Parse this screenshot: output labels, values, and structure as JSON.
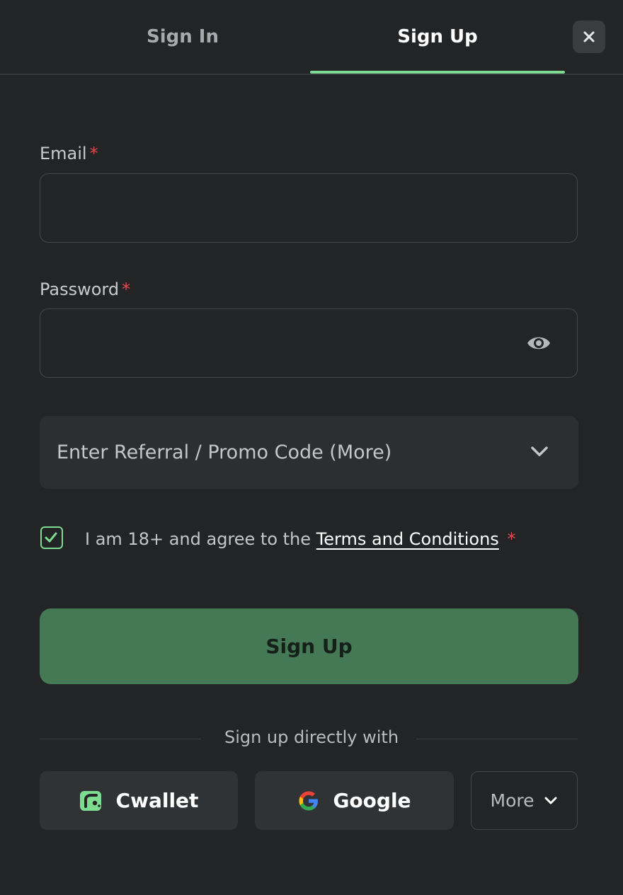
{
  "tabs": {
    "signin": "Sign In",
    "signup": "Sign Up",
    "active": "signup"
  },
  "form": {
    "email_label": "Email",
    "email_value": "",
    "password_label": "Password",
    "password_value": "",
    "required_mark": "*",
    "promo_label": "Enter Referral / Promo Code (More)",
    "agree_prefix": "I am 18+ and agree to the",
    "terms_link": "Terms and Conditions",
    "agree_checked": true,
    "submit_label": "Sign Up"
  },
  "social": {
    "divider_text": "Sign up directly with",
    "cwallet_label": "Cwallet",
    "google_label": "Google",
    "more_label": "More"
  },
  "icons": {
    "close": "close-icon",
    "eye": "eye-icon",
    "chevron": "chevron-down-icon",
    "check": "check-icon",
    "cwallet": "cwallet-logo-icon",
    "google": "google-logo-icon"
  },
  "colors": {
    "accent": "#7ddc8f",
    "primary_button": "#457854",
    "required": "#e54b4b",
    "background": "#232425"
  }
}
